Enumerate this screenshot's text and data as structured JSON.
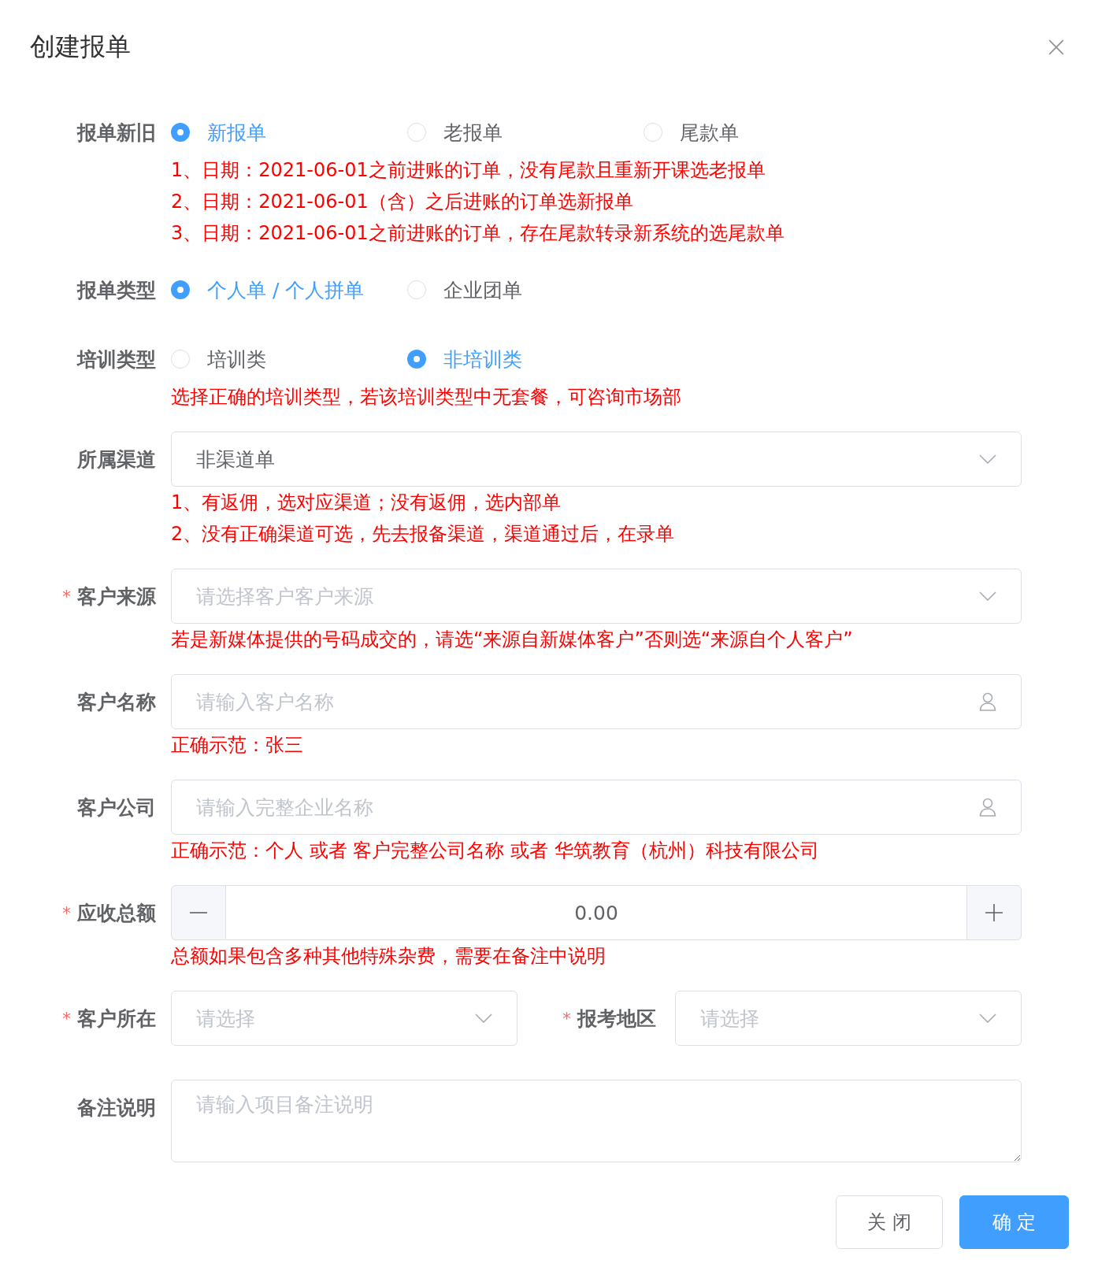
{
  "dialog": {
    "title": "创建报单"
  },
  "fields": [
    {
      "kind": "radio",
      "label": "报单新旧",
      "options": [
        {
          "label": "新报单",
          "selected": true
        },
        {
          "label": "老报单",
          "selected": false
        },
        {
          "label": "尾款单",
          "selected": false
        }
      ],
      "hints": [
        "1、日期：2021-06-01之前进账的订单，没有尾款且重新开课选老报单",
        "2、日期：2021-06-01（含）之后进账的订单选新报单",
        "3、日期：2021-06-01之前进账的订单，存在尾款转录新系统的选尾款单"
      ]
    },
    {
      "kind": "radio",
      "label": "报单类型",
      "options": [
        {
          "label": "个人单 / 个人拼单",
          "selected": true
        },
        {
          "label": "企业团单",
          "selected": false
        }
      ]
    },
    {
      "kind": "radio",
      "label": "培训类型",
      "options": [
        {
          "label": "培训类",
          "selected": false
        },
        {
          "label": "非培训类",
          "selected": true
        }
      ],
      "hints": [
        "选择正确的培训类型，若该培训类型中无套餐，可咨询市场部"
      ]
    },
    {
      "kind": "select",
      "label": "所属渠道",
      "value": "非渠道单",
      "hints": [
        "1、有返佣，选对应渠道；没有返佣，选内部单",
        "2、没有正确渠道可选，先去报备渠道，渠道通过后，在录单"
      ]
    },
    {
      "kind": "select",
      "label": "客户来源",
      "required_mark": "*",
      "placeholder": "请选择客户客户来源",
      "hints": [
        "若是新媒体提供的号码成交的，请选“来源自新媒体客户”否则选“来源自个人客户”"
      ]
    },
    {
      "kind": "input",
      "label": "客户名称",
      "placeholder": "请输入客户名称",
      "hints": [
        "正确示范：张三"
      ]
    },
    {
      "kind": "input",
      "label": "客户公司",
      "placeholder": "请输入完整企业名称",
      "hints": [
        "正确示范：个人 或者 客户完整公司名称 或者 华筑教育（杭州）科技有限公司"
      ]
    },
    {
      "kind": "number",
      "label": "应收总额",
      "required_mark": "*",
      "value": "0.00",
      "hints": [
        "总额如果包含多种其他特殊杂费，需要在备注中说明"
      ]
    },
    {
      "kind": "pair",
      "label": "客户所在",
      "required_mark": "*",
      "placeholder": "请选择",
      "second": {
        "label": "报考地区",
        "required_mark": "*",
        "placeholder": "请选择"
      }
    },
    {
      "kind": "textarea",
      "label": "备注说明",
      "placeholder": "请输入项目备注说明"
    }
  ],
  "buttons": [
    {
      "label": "关 闭",
      "kind": "secondary"
    },
    {
      "label": "确 定",
      "kind": "primary"
    }
  ]
}
